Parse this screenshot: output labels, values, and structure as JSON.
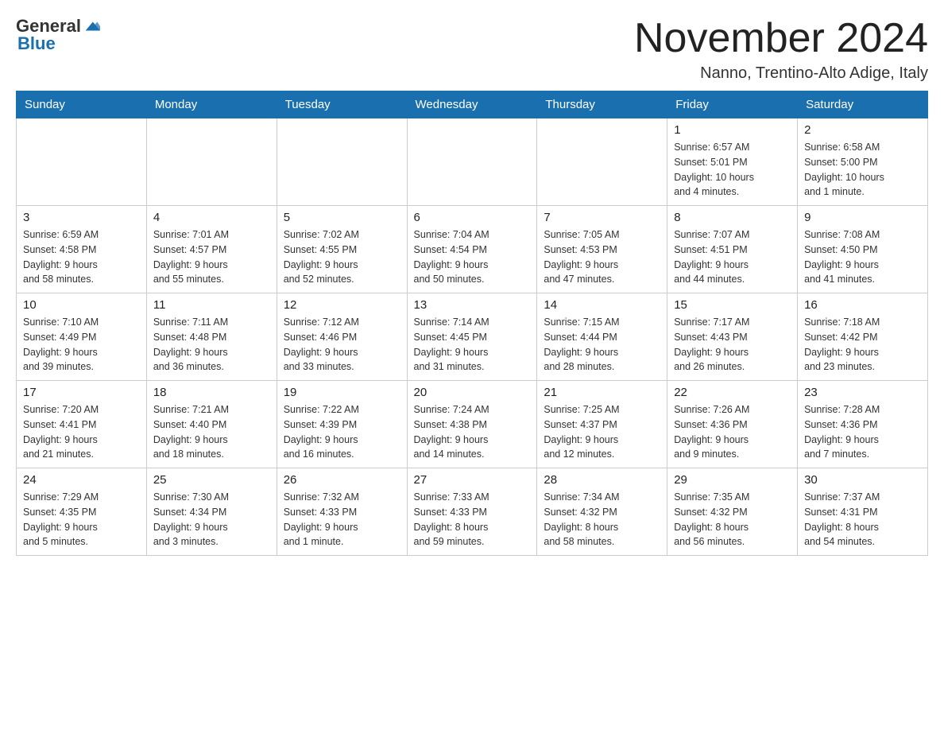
{
  "header": {
    "logo": {
      "general": "General",
      "blue": "Blue"
    },
    "title": "November 2024",
    "location": "Nanno, Trentino-Alto Adige, Italy"
  },
  "weekdays": [
    "Sunday",
    "Monday",
    "Tuesday",
    "Wednesday",
    "Thursday",
    "Friday",
    "Saturday"
  ],
  "weeks": [
    [
      {
        "day": "",
        "info": ""
      },
      {
        "day": "",
        "info": ""
      },
      {
        "day": "",
        "info": ""
      },
      {
        "day": "",
        "info": ""
      },
      {
        "day": "",
        "info": ""
      },
      {
        "day": "1",
        "info": "Sunrise: 6:57 AM\nSunset: 5:01 PM\nDaylight: 10 hours\nand 4 minutes."
      },
      {
        "day": "2",
        "info": "Sunrise: 6:58 AM\nSunset: 5:00 PM\nDaylight: 10 hours\nand 1 minute."
      }
    ],
    [
      {
        "day": "3",
        "info": "Sunrise: 6:59 AM\nSunset: 4:58 PM\nDaylight: 9 hours\nand 58 minutes."
      },
      {
        "day": "4",
        "info": "Sunrise: 7:01 AM\nSunset: 4:57 PM\nDaylight: 9 hours\nand 55 minutes."
      },
      {
        "day": "5",
        "info": "Sunrise: 7:02 AM\nSunset: 4:55 PM\nDaylight: 9 hours\nand 52 minutes."
      },
      {
        "day": "6",
        "info": "Sunrise: 7:04 AM\nSunset: 4:54 PM\nDaylight: 9 hours\nand 50 minutes."
      },
      {
        "day": "7",
        "info": "Sunrise: 7:05 AM\nSunset: 4:53 PM\nDaylight: 9 hours\nand 47 minutes."
      },
      {
        "day": "8",
        "info": "Sunrise: 7:07 AM\nSunset: 4:51 PM\nDaylight: 9 hours\nand 44 minutes."
      },
      {
        "day": "9",
        "info": "Sunrise: 7:08 AM\nSunset: 4:50 PM\nDaylight: 9 hours\nand 41 minutes."
      }
    ],
    [
      {
        "day": "10",
        "info": "Sunrise: 7:10 AM\nSunset: 4:49 PM\nDaylight: 9 hours\nand 39 minutes."
      },
      {
        "day": "11",
        "info": "Sunrise: 7:11 AM\nSunset: 4:48 PM\nDaylight: 9 hours\nand 36 minutes."
      },
      {
        "day": "12",
        "info": "Sunrise: 7:12 AM\nSunset: 4:46 PM\nDaylight: 9 hours\nand 33 minutes."
      },
      {
        "day": "13",
        "info": "Sunrise: 7:14 AM\nSunset: 4:45 PM\nDaylight: 9 hours\nand 31 minutes."
      },
      {
        "day": "14",
        "info": "Sunrise: 7:15 AM\nSunset: 4:44 PM\nDaylight: 9 hours\nand 28 minutes."
      },
      {
        "day": "15",
        "info": "Sunrise: 7:17 AM\nSunset: 4:43 PM\nDaylight: 9 hours\nand 26 minutes."
      },
      {
        "day": "16",
        "info": "Sunrise: 7:18 AM\nSunset: 4:42 PM\nDaylight: 9 hours\nand 23 minutes."
      }
    ],
    [
      {
        "day": "17",
        "info": "Sunrise: 7:20 AM\nSunset: 4:41 PM\nDaylight: 9 hours\nand 21 minutes."
      },
      {
        "day": "18",
        "info": "Sunrise: 7:21 AM\nSunset: 4:40 PM\nDaylight: 9 hours\nand 18 minutes."
      },
      {
        "day": "19",
        "info": "Sunrise: 7:22 AM\nSunset: 4:39 PM\nDaylight: 9 hours\nand 16 minutes."
      },
      {
        "day": "20",
        "info": "Sunrise: 7:24 AM\nSunset: 4:38 PM\nDaylight: 9 hours\nand 14 minutes."
      },
      {
        "day": "21",
        "info": "Sunrise: 7:25 AM\nSunset: 4:37 PM\nDaylight: 9 hours\nand 12 minutes."
      },
      {
        "day": "22",
        "info": "Sunrise: 7:26 AM\nSunset: 4:36 PM\nDaylight: 9 hours\nand 9 minutes."
      },
      {
        "day": "23",
        "info": "Sunrise: 7:28 AM\nSunset: 4:36 PM\nDaylight: 9 hours\nand 7 minutes."
      }
    ],
    [
      {
        "day": "24",
        "info": "Sunrise: 7:29 AM\nSunset: 4:35 PM\nDaylight: 9 hours\nand 5 minutes."
      },
      {
        "day": "25",
        "info": "Sunrise: 7:30 AM\nSunset: 4:34 PM\nDaylight: 9 hours\nand 3 minutes."
      },
      {
        "day": "26",
        "info": "Sunrise: 7:32 AM\nSunset: 4:33 PM\nDaylight: 9 hours\nand 1 minute."
      },
      {
        "day": "27",
        "info": "Sunrise: 7:33 AM\nSunset: 4:33 PM\nDaylight: 8 hours\nand 59 minutes."
      },
      {
        "day": "28",
        "info": "Sunrise: 7:34 AM\nSunset: 4:32 PM\nDaylight: 8 hours\nand 58 minutes."
      },
      {
        "day": "29",
        "info": "Sunrise: 7:35 AM\nSunset: 4:32 PM\nDaylight: 8 hours\nand 56 minutes."
      },
      {
        "day": "30",
        "info": "Sunrise: 7:37 AM\nSunset: 4:31 PM\nDaylight: 8 hours\nand 54 minutes."
      }
    ]
  ]
}
